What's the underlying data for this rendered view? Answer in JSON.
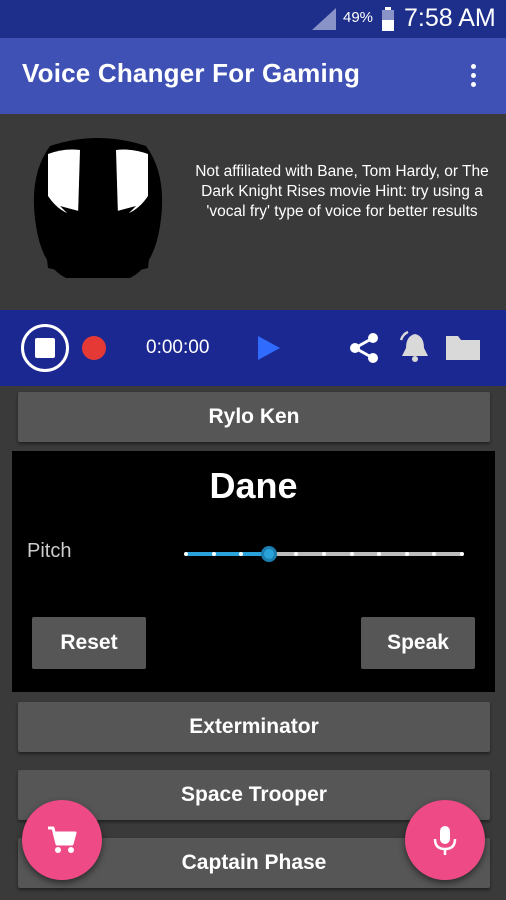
{
  "status_bar": {
    "battery_percent": "49%",
    "time": "7:58 AM",
    "icons": [
      "signal-icon",
      "battery-icon"
    ]
  },
  "app_bar": {
    "title": "Voice Changer For Gaming",
    "menu_icon": "overflow-menu-icon"
  },
  "hero": {
    "image": "bane-mask-icon",
    "disclaimer": "Not affiliated with Bane, Tom Hardy, or The Dark Knight Rises movie Hint: try using a 'vocal fry' type of voice for better results"
  },
  "player": {
    "time": "0:00:00",
    "icons": [
      "stop-icon",
      "record-icon",
      "play-icon",
      "share-icon",
      "bell-icon",
      "folder-icon"
    ]
  },
  "voices": {
    "above": "Rylo Ken",
    "below": [
      "Exterminator",
      "Space Trooper",
      "Captain Phase"
    ]
  },
  "selected_voice": {
    "name": "Dane",
    "pitch_label": "Pitch",
    "pitch_step": 3,
    "pitch_steps_total": 10,
    "reset_label": "Reset",
    "speak_label": "Speak"
  },
  "fabs": {
    "left_icon": "shopping-cart-icon",
    "right_icon": "microphone-icon"
  },
  "colors": {
    "status_bar": "#1d2f8a",
    "app_bar": "#3f51b5",
    "player_bar": "#1b2891",
    "accent": "#29a3d9",
    "fab": "#ee4a86",
    "record": "#e53935"
  }
}
